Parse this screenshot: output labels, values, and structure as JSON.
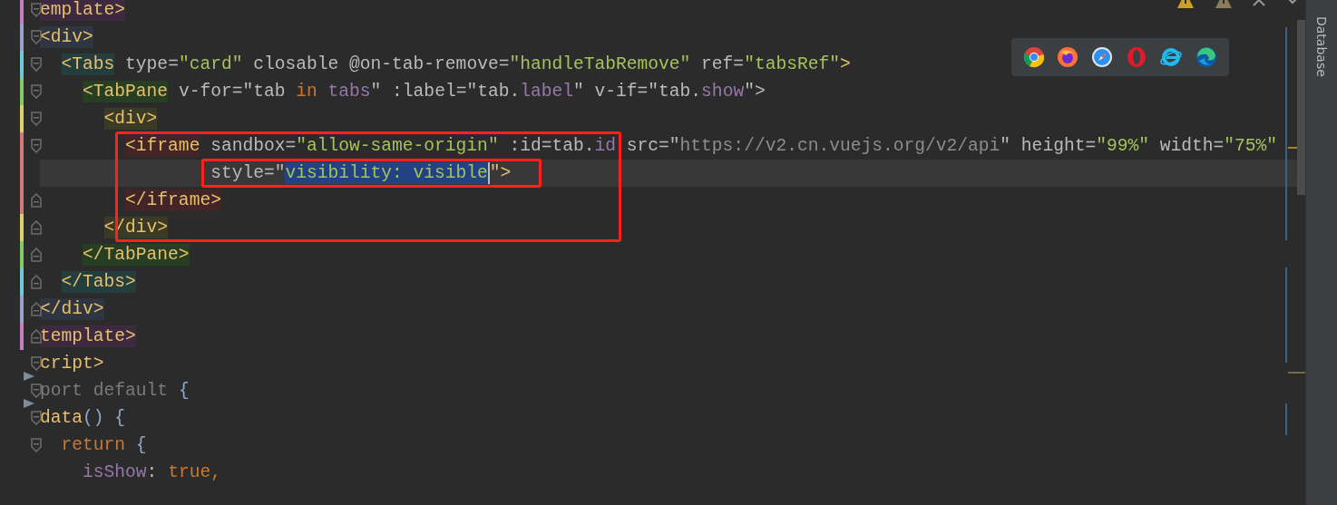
{
  "lines": [
    {
      "kind": "fold_start",
      "color": "#c77dbb",
      "current": false,
      "tokens": [
        {
          "text": "emplate>",
          "kind": "tag",
          "color": "#3d2a40"
        }
      ]
    },
    {
      "kind": "fold_start",
      "color": "#9aa0d0",
      "current": false,
      "tokens": [
        {
          "text": "<div>",
          "kind": "tag",
          "color": "#2f3541"
        }
      ]
    },
    {
      "kind": "fold_start",
      "color": "#6fc8d6",
      "current": false,
      "tokens": [
        {
          "text": "  <Tabs",
          "kind": "tag",
          "color": "#243d3d"
        },
        {
          "text": " type=",
          "kind": "attr"
        },
        {
          "text": "\"card\"",
          "kind": "str"
        },
        {
          "text": " closable @on-tab-remove=",
          "kind": "attr"
        },
        {
          "text": "\"handleTabRemove\"",
          "kind": "str"
        },
        {
          "text": " ref=",
          "kind": "attr"
        },
        {
          "text": "\"tabsRef\"",
          "kind": "str"
        },
        {
          "text": ">",
          "kind": "tag"
        }
      ]
    },
    {
      "kind": "fold_start",
      "color": "#86c96a",
      "current": false,
      "tokens": [
        {
          "text": "    <TabPane",
          "kind": "tag",
          "color": "#263f23"
        },
        {
          "text": " v-for=\"tab ",
          "kind": "attr"
        },
        {
          "text": "in",
          "kind": "keyword"
        },
        {
          "text": " tabs",
          "kind": "prop"
        },
        {
          "text": "\" :label=\"tab.",
          "kind": "attr"
        },
        {
          "text": "label",
          "kind": "prop"
        },
        {
          "text": "\" v-if=\"tab.",
          "kind": "attr"
        },
        {
          "text": "show",
          "kind": "prop"
        },
        {
          "text": "\">",
          "kind": "attr"
        }
      ]
    },
    {
      "kind": "fold_start",
      "color": "#d8d26a",
      "current": false,
      "tokens": [
        {
          "text": "      <div>",
          "kind": "tag",
          "color": "#3b3a24"
        }
      ]
    },
    {
      "kind": "fold_start",
      "color": "#d47a7a",
      "current": false,
      "tokens": [
        {
          "text": "        <iframe",
          "kind": "tag",
          "color": "#432528"
        },
        {
          "text": " sandbox=",
          "kind": "attr"
        },
        {
          "text": "\"allow-same-origin\"",
          "kind": "str"
        },
        {
          "text": " :id=tab.",
          "kind": "attr"
        },
        {
          "text": "id",
          "kind": "prop"
        },
        {
          "text": " src=\"",
          "kind": "attr"
        },
        {
          "text": "https://v2.cn.vuejs.org/v2/api",
          "kind": "url"
        },
        {
          "text": "\"",
          "kind": "attr"
        },
        {
          "text": " height=",
          "kind": "attr"
        },
        {
          "text": "\"99%\"",
          "kind": "str"
        },
        {
          "text": " width=",
          "kind": "attr"
        },
        {
          "text": "\"75%\"",
          "kind": "str"
        }
      ]
    },
    {
      "kind": "plain",
      "color": "#d47a7a",
      "current": true,
      "tokens": [
        {
          "text": "                style=\"",
          "kind": "attr"
        },
        {
          "text": "visibility: visible",
          "kind": "selected"
        },
        {
          "text": "\">",
          "kind": "tag"
        }
      ]
    },
    {
      "kind": "fold_end",
      "color": "#d47a7a",
      "current": false,
      "tokens": [
        {
          "text": "        </iframe>",
          "kind": "tag",
          "color": "#432528"
        }
      ]
    },
    {
      "kind": "fold_end",
      "color": "#d8d26a",
      "current": false,
      "tokens": [
        {
          "text": "      </div>",
          "kind": "tag",
          "color": "#3b3a24"
        }
      ]
    },
    {
      "kind": "fold_end",
      "color": "#86c96a",
      "current": false,
      "tokens": [
        {
          "text": "    </TabPane>",
          "kind": "tag",
          "color": "#263f23"
        }
      ]
    },
    {
      "kind": "fold_end",
      "color": "#6fc8d6",
      "current": false,
      "tokens": [
        {
          "text": "  </Tabs>",
          "kind": "tag",
          "color": "#243d3d"
        }
      ]
    },
    {
      "kind": "fold_end",
      "color": "#9aa0d0",
      "current": false,
      "tokens": [
        {
          "text": "</div>",
          "kind": "tag",
          "color": "#2f3541"
        }
      ]
    },
    {
      "kind": "fold_end",
      "color": "#c77dbb",
      "current": false,
      "tokens": [
        {
          "text": "template>",
          "kind": "tag",
          "color": "#3d2a40"
        }
      ]
    },
    {
      "kind": "fold_start",
      "current": false,
      "tokens": [
        {
          "text": "cript>",
          "kind": "tag"
        }
      ]
    },
    {
      "kind": "fold_start",
      "run": true,
      "current": false,
      "tokens": [
        {
          "text": "port default",
          "kind": "comment"
        },
        {
          "text": " {",
          "kind": "brace"
        }
      ]
    },
    {
      "kind": "fold_start",
      "run": true,
      "current": false,
      "tokens": [
        {
          "text": "data",
          "kind": "tag"
        },
        {
          "text": "() {",
          "kind": "brace"
        }
      ]
    },
    {
      "kind": "fold_start",
      "current": false,
      "tokens": [
        {
          "text": "  return",
          "kind": "keyword"
        },
        {
          "text": " {",
          "kind": "brace"
        }
      ]
    },
    {
      "kind": "plain",
      "current": false,
      "tokens": [
        {
          "text": "    isShow",
          "kind": "prop"
        },
        {
          "text": ": ",
          "kind": "attr"
        },
        {
          "text": "true,",
          "kind": "keyword"
        }
      ]
    }
  ],
  "annotations": [
    {
      "kind": "rect",
      "color": "#ff2020"
    },
    {
      "kind": "rect",
      "color": "#ff2020"
    }
  ],
  "browsers": [
    {
      "kind": "chrome"
    },
    {
      "kind": "firefox"
    },
    {
      "kind": "safari"
    },
    {
      "kind": "opera"
    },
    {
      "kind": "ie"
    },
    {
      "kind": "edge"
    }
  ],
  "editor_toolbar": [
    {
      "kind": "warning"
    },
    {
      "kind": "weak_warning"
    },
    {
      "kind": "close"
    },
    {
      "kind": "chevron"
    }
  ],
  "side_tab": {
    "label": "Database"
  }
}
